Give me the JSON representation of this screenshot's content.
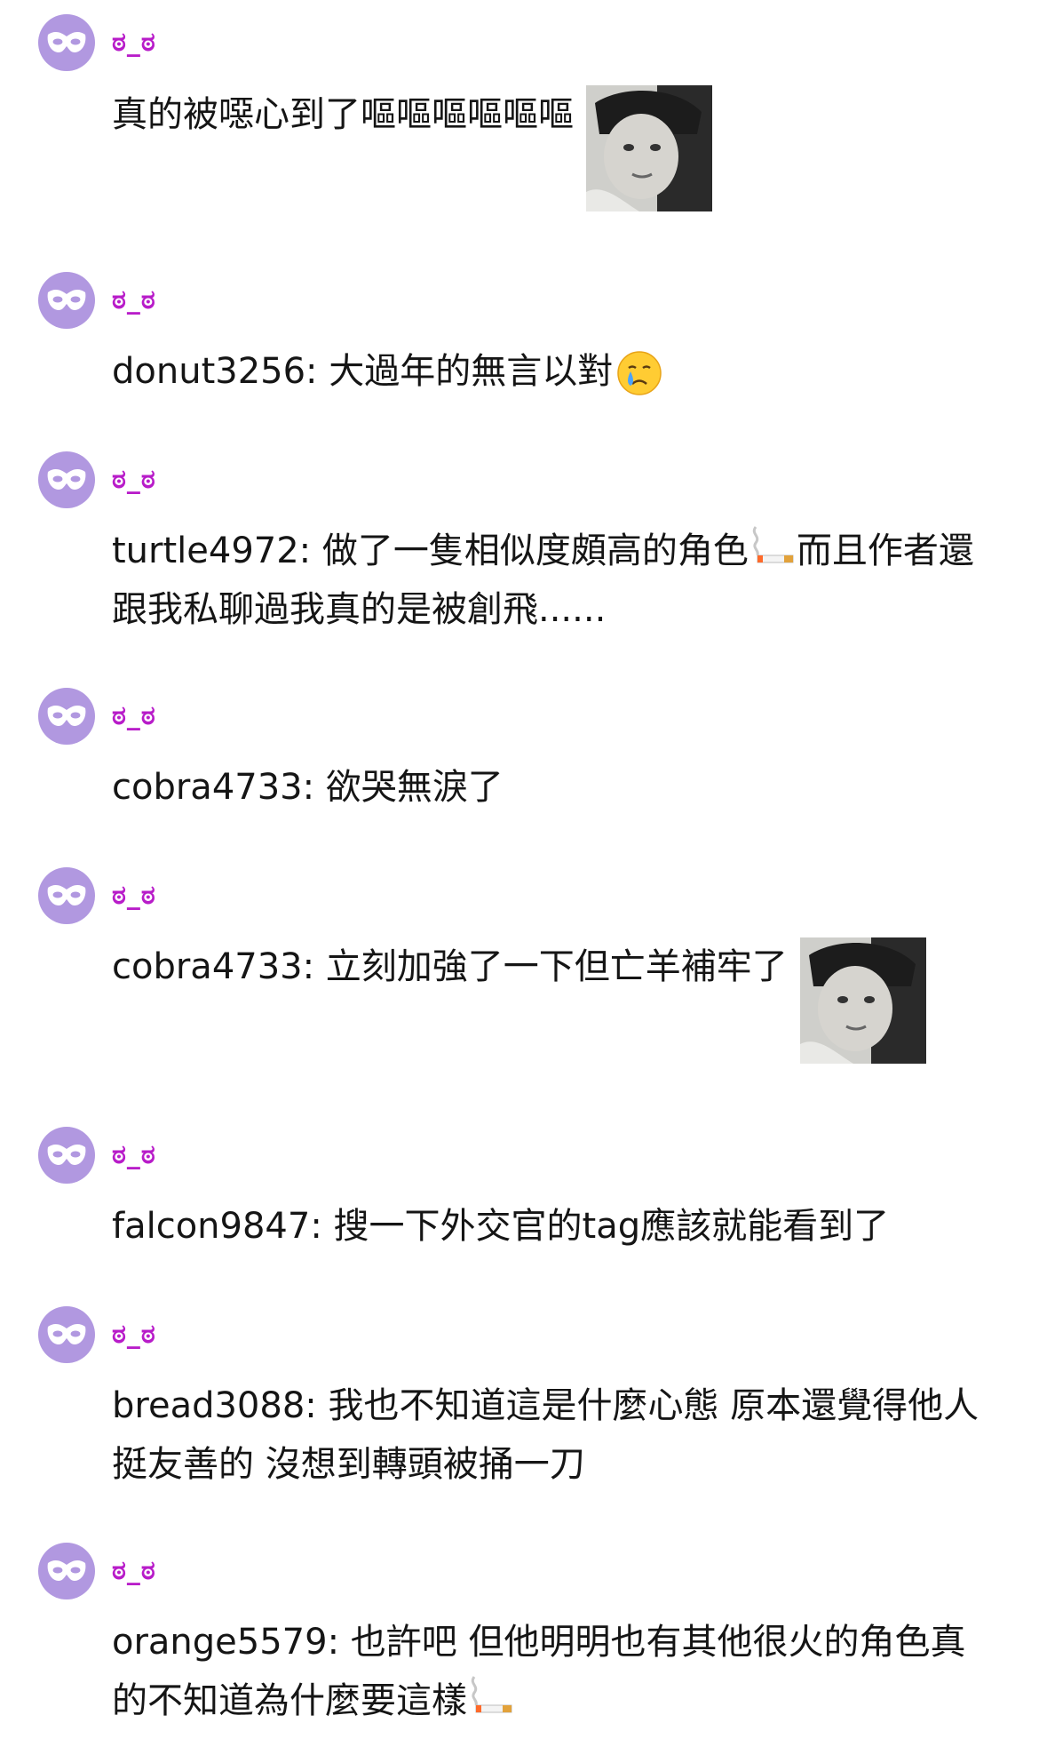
{
  "colors": {
    "avatar_bg": "#b198e0",
    "username": "#b81cc9",
    "text": "#151515"
  },
  "icons": {
    "avatar": "mask-icon",
    "smoking": "cigarette-icon",
    "crying": "crying-face-icon",
    "sticker": "face-sticker-image"
  },
  "messages": [
    {
      "username": "ಠ_ಠ",
      "text": "真的被噁心到了嘔嘔嘔嘔嘔嘔"
    },
    {
      "username": "ಠ_ಠ",
      "text": "donut3256: 大過年的無言以對"
    },
    {
      "username": "ಠ_ಠ",
      "text_a": "turtle4972: 做了一隻相似度頗高的角色",
      "text_b": "而且作者還跟我私聊過我真的是被創飛......"
    },
    {
      "username": "ಠ_ಠ",
      "text": "cobra4733: 欲哭無淚了"
    },
    {
      "username": "ಠ_ಠ",
      "text": "cobra4733: 立刻加強了一下但亡羊補牢了"
    },
    {
      "username": "ಠ_ಠ",
      "text": "falcon9847: 搜一下外交官的tag應該就能看到了"
    },
    {
      "username": "ಠ_ಠ",
      "text": "bread3088: 我也不知道這是什麼心態 原本還覺得他人挺友善的 沒想到轉頭被捅一刀"
    },
    {
      "username": "ಠ_ಠ",
      "text": "orange5579: 也許吧 但他明明也有其他很火的角色真的不知道為什麼要這樣"
    }
  ]
}
